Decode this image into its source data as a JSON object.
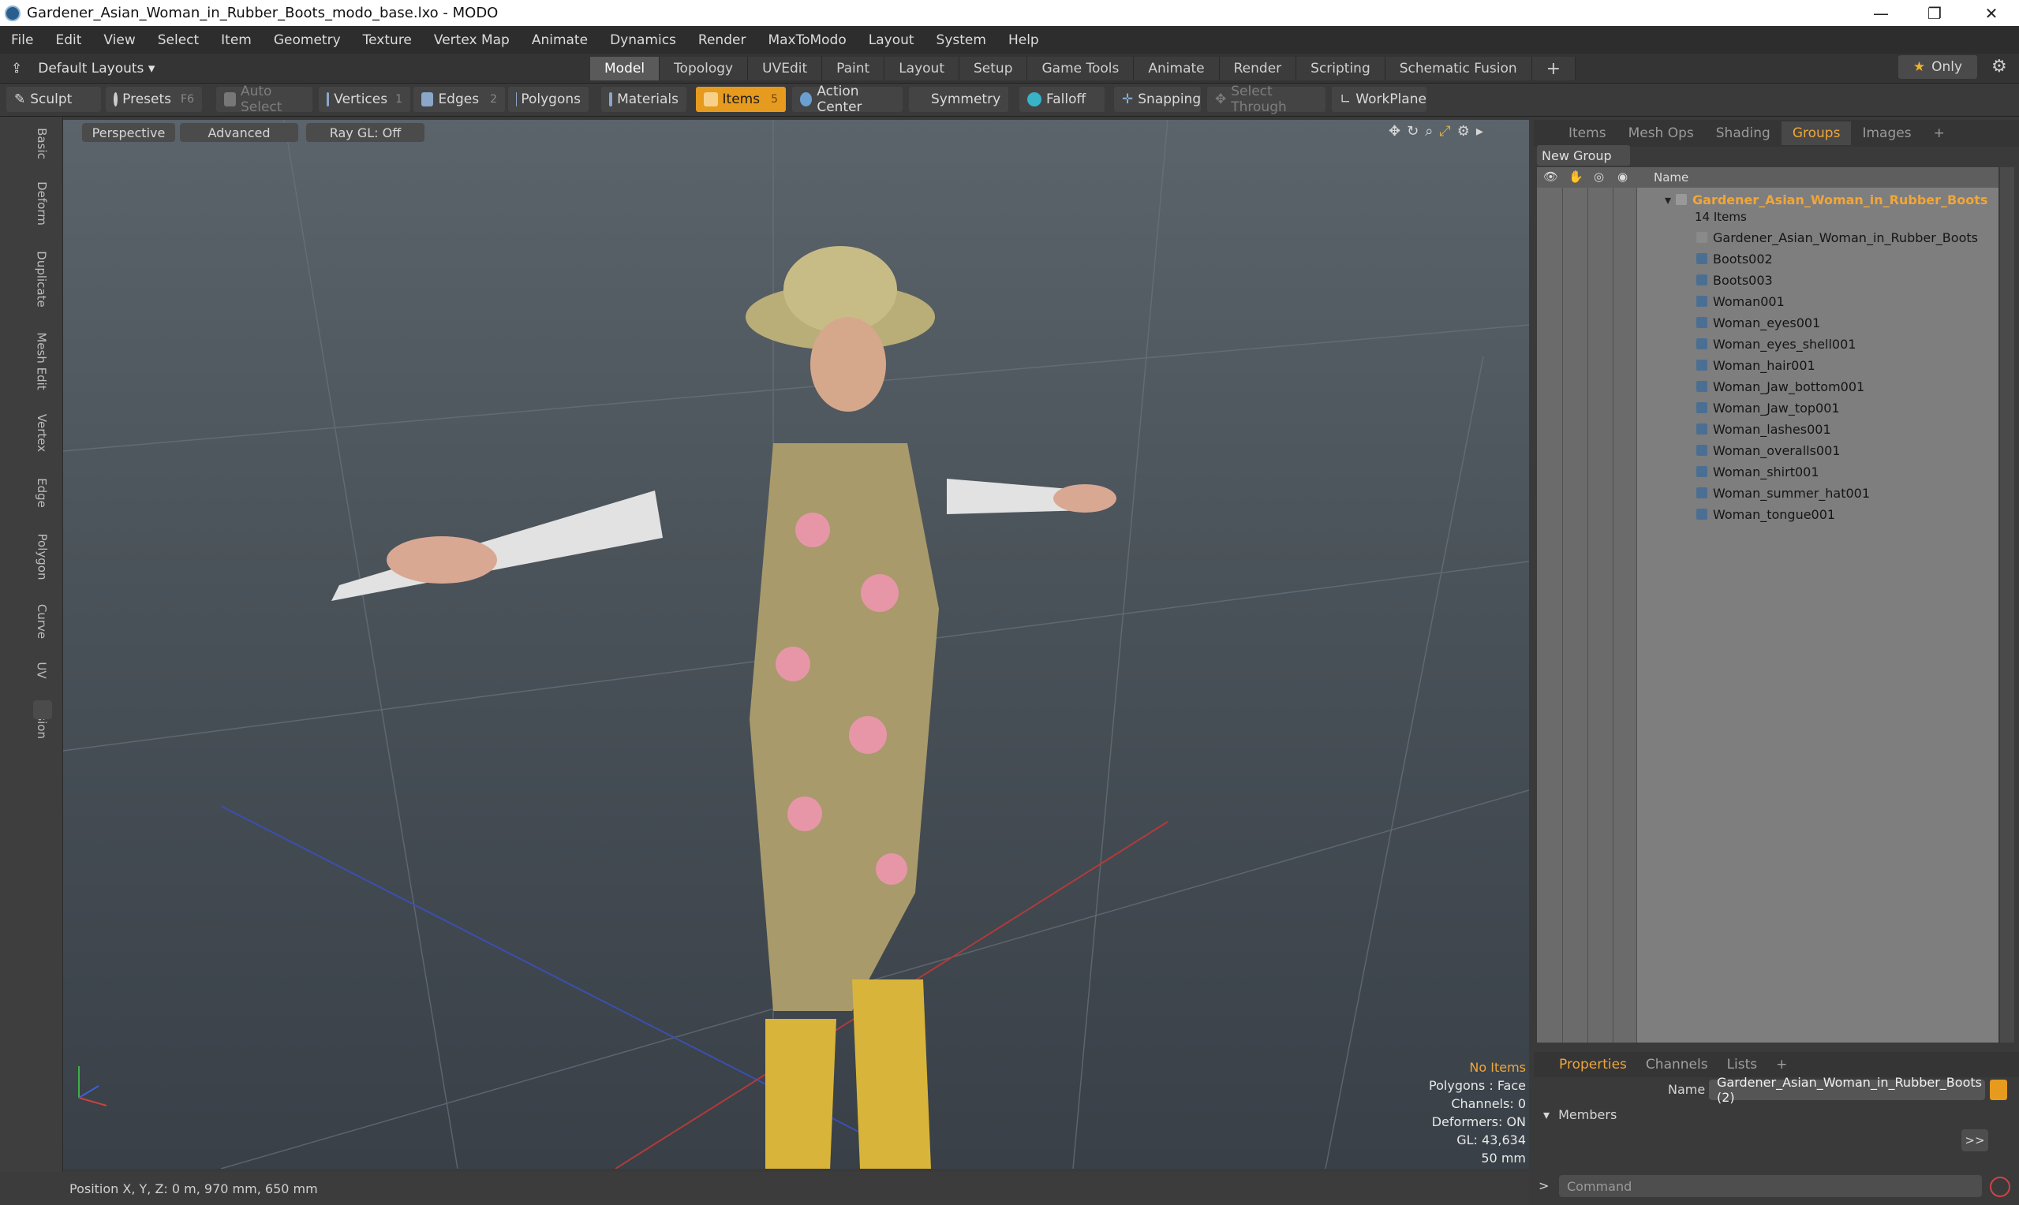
{
  "window": {
    "title": "Gardener_Asian_Woman_in_Rubber_Boots_modo_base.lxo - MODO"
  },
  "menu": [
    "File",
    "Edit",
    "View",
    "Select",
    "Item",
    "Geometry",
    "Texture",
    "Vertex Map",
    "Animate",
    "Dynamics",
    "Render",
    "MaxToModo",
    "Layout",
    "System",
    "Help"
  ],
  "layouts": {
    "label": "Default Layouts ▾"
  },
  "tabs": [
    "Model",
    "Topology",
    "UVEdit",
    "Paint",
    "Layout",
    "Setup",
    "Game Tools",
    "Animate",
    "Render",
    "Scripting",
    "Schematic Fusion"
  ],
  "only_label": "Only",
  "toolbar": {
    "sculpt": "Sculpt",
    "presets": "Presets",
    "presets_key": "F6",
    "auto_select": "Auto Select",
    "vertices": "Vertices",
    "vertices_key": "1",
    "edges": "Edges",
    "edges_key": "2",
    "polygons": "Polygons",
    "materials": "Materials",
    "items": "Items",
    "items_key": "5",
    "action_center": "Action Center",
    "symmetry": "Symmetry",
    "falloff": "Falloff",
    "snapping": "Snapping",
    "select_through": "Select Through",
    "workplane": "WorkPlane"
  },
  "left_tabs": [
    "Basic",
    "Deform",
    "Duplicate",
    "Mesh Edit",
    "Vertex",
    "Edge",
    "Polygon",
    "Curve",
    "UV",
    "Fusion"
  ],
  "viewport": {
    "perspective": "Perspective",
    "advanced": "Advanced",
    "raygl": "Ray GL: Off",
    "info": {
      "selection": "No Items",
      "polygons": "Polygons : Face",
      "channels": "Channels: 0",
      "deformers": "Deformers: ON",
      "gl": "GL: 43,634",
      "focal": "50 mm"
    }
  },
  "status": {
    "position": "Position X, Y, Z:   0 m, 970 mm, 650 mm"
  },
  "right_panel": {
    "tabs": [
      "Items",
      "Mesh Ops",
      "Shading",
      "Groups",
      "Images"
    ],
    "active_tab": "Groups",
    "new_group": "New Group",
    "name_header": "Name",
    "group": {
      "name": "Gardener_Asian_Woman_in_Rubber_Boots",
      "count": "14 Items"
    },
    "items": [
      "Gardener_Asian_Woman_in_Rubber_Boots",
      "Boots002",
      "Boots003",
      "Woman001",
      "Woman_eyes001",
      "Woman_eyes_shell001",
      "Woman_hair001",
      "Woman_Jaw_bottom001",
      "Woman_Jaw_top001",
      "Woman_lashes001",
      "Woman_overalls001",
      "Woman_shirt001",
      "Woman_summer_hat001",
      "Woman_tongue001"
    ]
  },
  "properties": {
    "tabs": [
      "Properties",
      "Channels",
      "Lists"
    ],
    "name_label": "Name",
    "name_value": "Gardener_Asian_Woman_in_Rubber_Boots (2)",
    "members_label": "Members",
    "more_button": ">>"
  },
  "command": {
    "placeholder": "Command"
  }
}
